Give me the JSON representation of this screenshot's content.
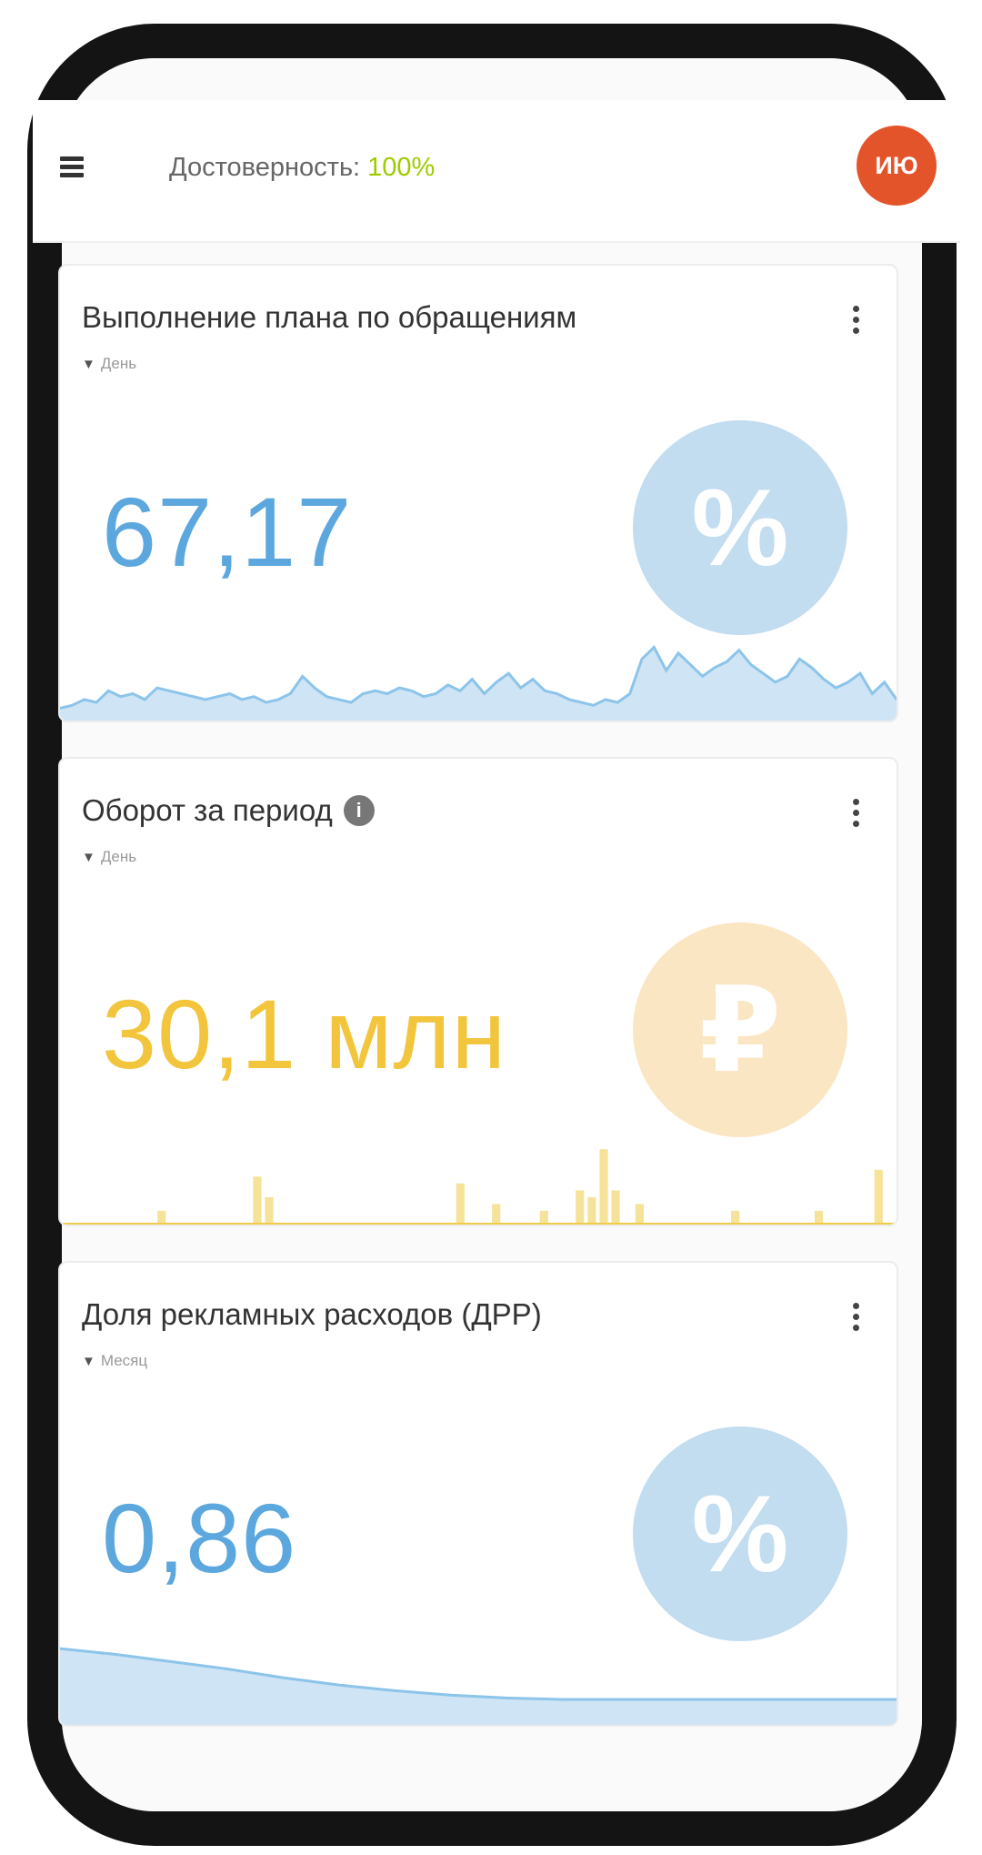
{
  "header": {
    "reliability_label": "Достоверность:",
    "reliability_value": "100%",
    "avatar_initials": "ИЮ"
  },
  "cards": [
    {
      "title": "Выполнение плана по обращениям",
      "filter": "День",
      "value": "67,17",
      "icon": "percent-icon",
      "icon_glyph": "%",
      "value_color": "#5ba7de",
      "icon_color": "#c2dcf0",
      "spark_series": [
        3,
        4,
        6,
        5,
        9,
        7,
        8,
        6,
        10,
        9,
        8,
        7,
        6,
        7,
        8,
        6,
        7,
        5,
        6,
        8,
        14,
        10,
        7,
        6,
        5,
        8,
        9,
        8,
        10,
        9,
        7,
        8,
        11,
        9,
        13,
        8,
        12,
        15,
        10,
        13,
        9,
        8,
        6,
        5,
        4,
        6,
        5,
        8,
        20,
        24,
        16,
        22,
        18,
        14,
        17,
        19,
        23,
        18,
        15,
        12,
        14,
        20,
        17,
        13,
        10,
        12,
        15,
        8,
        12,
        6
      ]
    },
    {
      "title": "Оборот за период",
      "filter": "День",
      "value": "30,1 млн",
      "icon": "ruble-icon",
      "icon_glyph": "₽",
      "value_color": "#f2c53d",
      "icon_color": "#fbe6c4",
      "spark_series": [
        0,
        0,
        0,
        0,
        0,
        0,
        0,
        0,
        4,
        0,
        0,
        0,
        0,
        0,
        0,
        0,
        14,
        8,
        0,
        0,
        0,
        0,
        0,
        0,
        0,
        0,
        0,
        0,
        0,
        0,
        0,
        0,
        0,
        12,
        0,
        0,
        6,
        0,
        0,
        0,
        4,
        0,
        0,
        10,
        8,
        22,
        10,
        0,
        6,
        0,
        0,
        0,
        0,
        0,
        0,
        0,
        4,
        0,
        0,
        0,
        0,
        0,
        0,
        4,
        0,
        0,
        0,
        0,
        16,
        0
      ]
    },
    {
      "title": "Доля рекламных расходов (ДРР)",
      "filter": "Месяц",
      "value": "0,86",
      "icon": "percent-icon",
      "icon_glyph": "%",
      "value_color": "#5ba7de",
      "icon_color": "#c2dcf0",
      "spark_series": [
        1.0,
        0.92,
        0.82,
        0.72,
        0.6,
        0.5,
        0.42,
        0.36,
        0.32,
        0.3,
        0.3,
        0.3,
        0.3,
        0.3,
        0.3,
        0.3
      ]
    }
  ],
  "colors": {
    "blue_fill": "#cfe4f5",
    "blue_line": "#8cc4ea",
    "yellow_fill": "#f6e39a",
    "yellow_line": "#f0cc4a"
  }
}
